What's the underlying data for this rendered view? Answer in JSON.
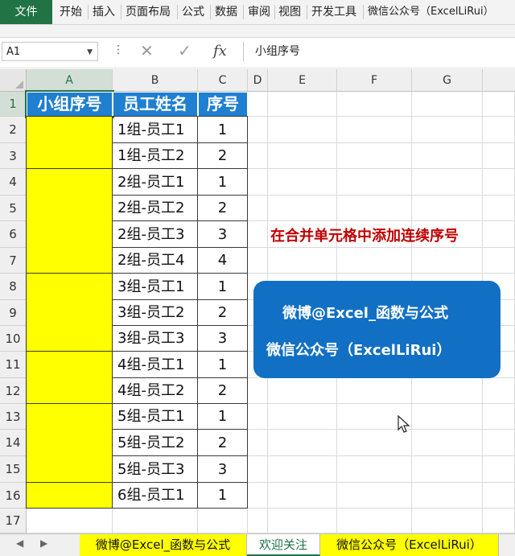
{
  "ribbon": {
    "file": "文件",
    "tabs": [
      "开始",
      "插入",
      "页面布局",
      "公式",
      "数据",
      "审阅",
      "视图",
      "开发工具",
      "微信公众号（ExcelLiRui）"
    ]
  },
  "formula_bar": {
    "name_box": "A1",
    "content": "小组序号",
    "cancel_icon": "x-icon",
    "enter_icon": "check-icon",
    "fx": "fx"
  },
  "columns": [
    "A",
    "B",
    "C",
    "D",
    "E",
    "F",
    "G"
  ],
  "rows": [
    "1",
    "2",
    "3",
    "4",
    "5",
    "6",
    "7",
    "8",
    "9",
    "10",
    "11",
    "12",
    "13",
    "14",
    "15",
    "16",
    "17"
  ],
  "table": {
    "headers": [
      "小组序号",
      "员工姓名",
      "序号"
    ],
    "names": [
      "1组-员工1",
      "1组-员工2",
      "2组-员工1",
      "2组-员工2",
      "2组-员工3",
      "2组-员工4",
      "3组-员工1",
      "3组-员工2",
      "3组-员工3",
      "4组-员工1",
      "4组-员工2",
      "5组-员工1",
      "5组-员工2",
      "5组-员工3",
      "6组-员工1"
    ],
    "numbers": [
      "1",
      "2",
      "1",
      "2",
      "3",
      "4",
      "1",
      "2",
      "3",
      "1",
      "2",
      "1",
      "2",
      "3",
      "1"
    ],
    "merged_group_rows": [
      [
        2,
        3
      ],
      [
        4,
        7
      ],
      [
        8,
        10
      ],
      [
        11,
        12
      ],
      [
        13,
        15
      ],
      [
        16,
        16
      ]
    ]
  },
  "annotation": {
    "title": "在合并单元格中添加连续序号",
    "line1": "微博@Excel_函数与公式",
    "line2": "微信公众号（ExcelLiRui）"
  },
  "sheets": [
    {
      "label": "微博@Excel_函数与公式",
      "style": "yellow"
    },
    {
      "label": "欢迎关注",
      "style": "active"
    },
    {
      "label": "微信公众号（ExcelLiRui）",
      "style": "yellow"
    }
  ],
  "colors": {
    "header_fill": "#1f7fd0",
    "merged_fill": "#ffff00",
    "title_red": "#c00000",
    "box_blue": "#1170c4",
    "excel_green": "#217346"
  }
}
